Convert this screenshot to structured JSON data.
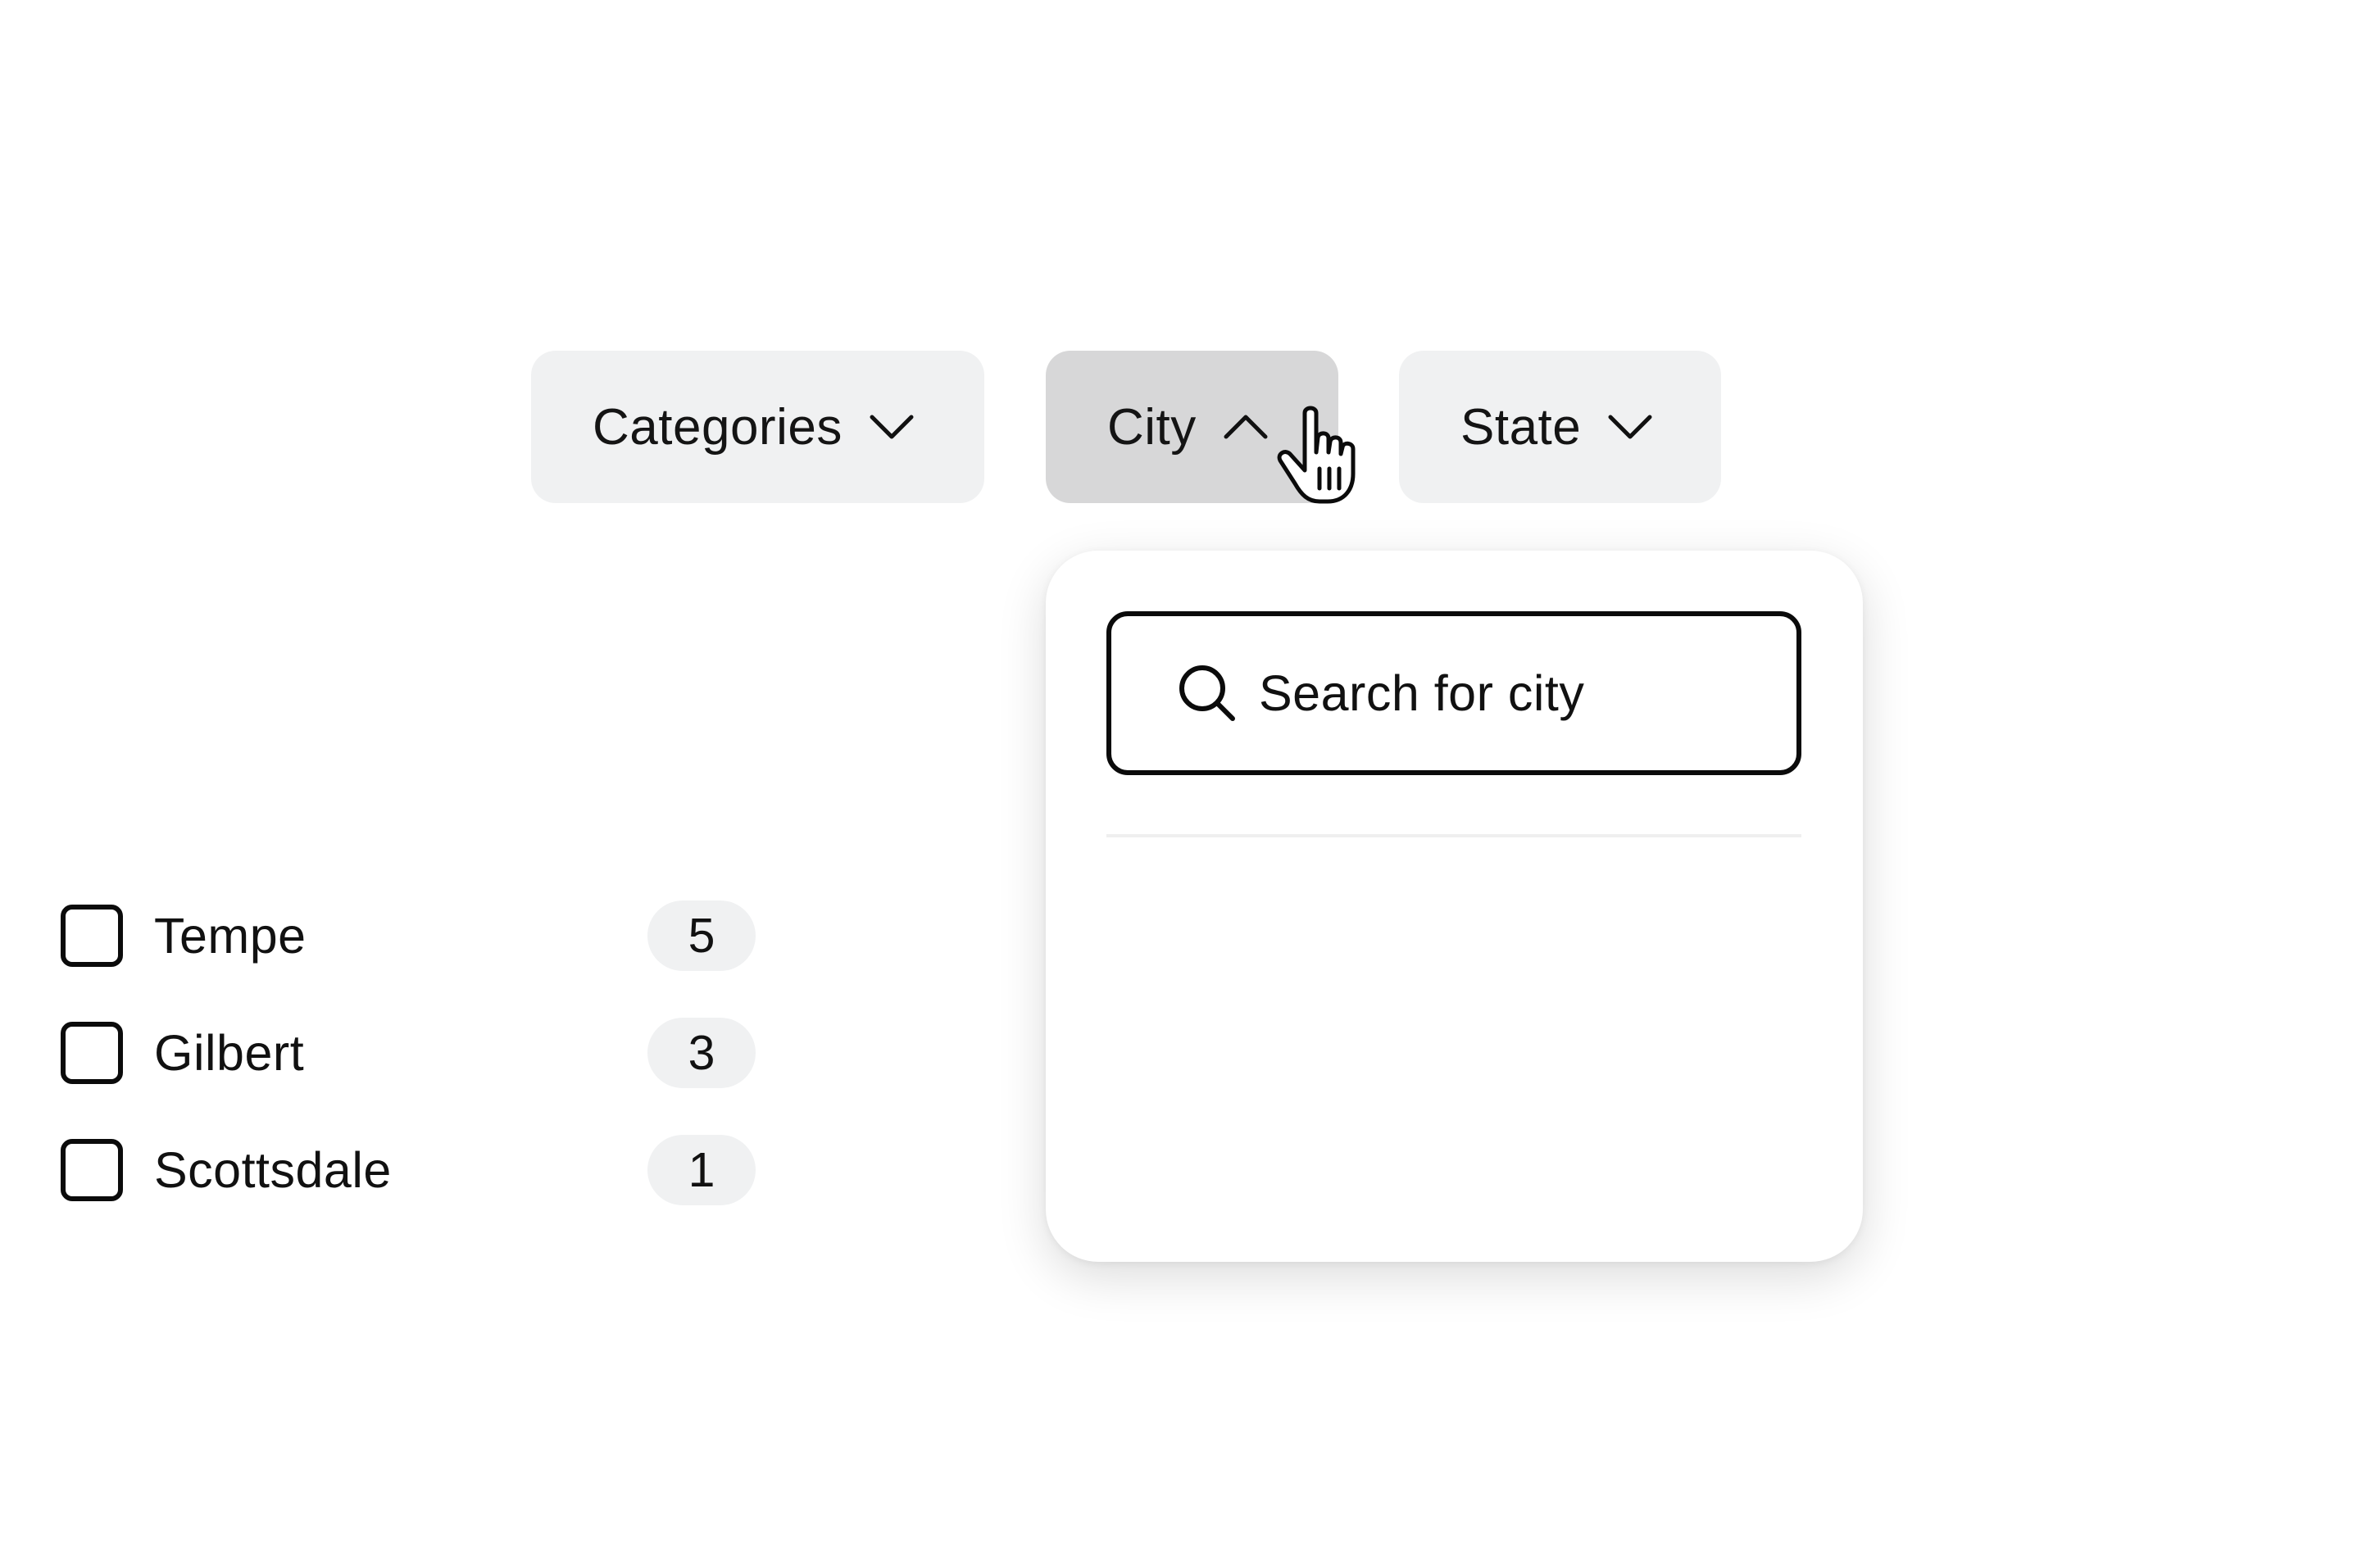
{
  "filters": [
    {
      "label": "Categories",
      "icon": "chevron-down-icon",
      "expanded": false
    },
    {
      "label": "City",
      "icon": "chevron-up-icon",
      "expanded": true
    },
    {
      "label": "State",
      "icon": "chevron-down-icon",
      "expanded": false
    }
  ],
  "city_dropdown": {
    "search": {
      "placeholder": "Search for city",
      "value": "",
      "icon": "search-icon"
    },
    "options": [
      {
        "label": "Tempe",
        "count": "5",
        "checked": false
      },
      {
        "label": "Gilbert",
        "count": "3",
        "checked": false
      },
      {
        "label": "Scottsdale",
        "count": "1",
        "checked": false
      }
    ]
  },
  "cursor": {
    "icon": "hand-pointer-icon"
  },
  "colors": {
    "button_bg": "#f0f1f2",
    "button_active_bg": "#d7d7d8",
    "text": "#111111",
    "border": "#0b0b0b",
    "panel_bg": "#ffffff"
  }
}
